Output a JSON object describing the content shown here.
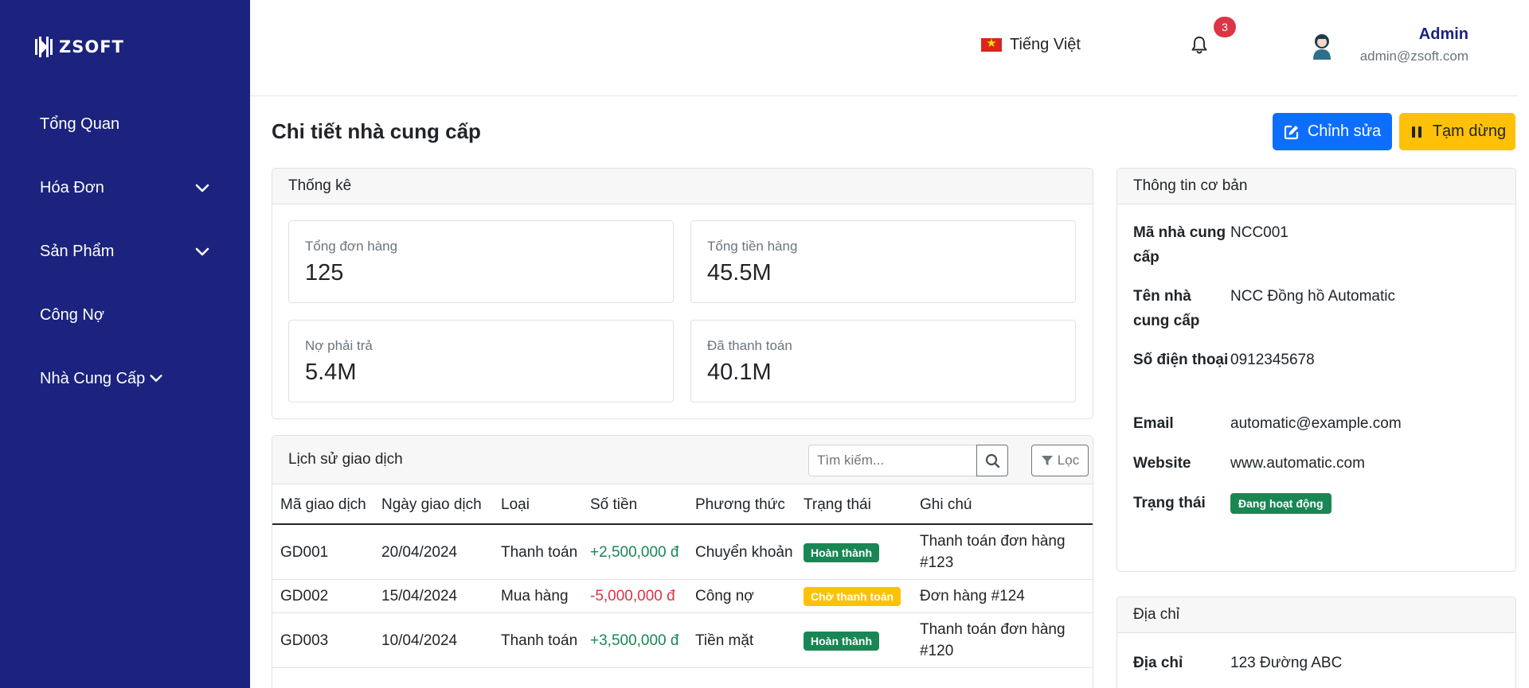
{
  "app": {
    "logo_text": "ZSOFT"
  },
  "sidebar": {
    "items": [
      {
        "label": "Tổng Quan",
        "has_chevron": false
      },
      {
        "label": "Hóa Đơn",
        "has_chevron": true
      },
      {
        "label": "Sản Phẩm",
        "has_chevron": true
      },
      {
        "label": "Công Nợ",
        "has_chevron": false
      },
      {
        "label": "Nhà Cung Cấp",
        "has_chevron": true
      }
    ],
    "bg_color": "#1b237e"
  },
  "header": {
    "language": "Tiếng Việt",
    "notification_count": "3",
    "user": {
      "name": "Admin",
      "email": "admin@zsoft.com"
    }
  },
  "page": {
    "title": "Chi tiết nhà cung cấp",
    "edit_label": "Chỉnh sửa",
    "pause_label": "Tạm dừng"
  },
  "stats": {
    "header": "Thống kê",
    "items": [
      {
        "label": "Tổng đơn hàng",
        "value": "125"
      },
      {
        "label": "Tổng tiền hàng",
        "value": "45.5M"
      },
      {
        "label": "Nợ phải trả",
        "value": "5.4M"
      },
      {
        "label": "Đã thanh toán",
        "value": "40.1M"
      }
    ]
  },
  "transactions": {
    "header": "Lịch sử giao dịch",
    "search_placeholder": "Tìm kiếm...",
    "filter_label": "Lọc",
    "columns": [
      "Mã giao dịch",
      "Ngày giao dịch",
      "Loại",
      "Số tiền",
      "Phương thức",
      "Trạng thái",
      "Ghi chú"
    ],
    "rows": [
      {
        "id": "GD001",
        "date": "20/04/2024",
        "type": "Thanh toán",
        "amount": "+2,500,000 đ",
        "method": "Chuyển khoản",
        "status": "Hoàn thành",
        "note": "Thanh toán đơn hàng #123"
      },
      {
        "id": "GD002",
        "date": "15/04/2024",
        "type": "Mua hàng",
        "amount": "-5,000,000 đ",
        "method": "Công nợ",
        "status": "Chờ thanh toán",
        "note": "Đơn hàng #124"
      },
      {
        "id": "GD003",
        "date": "10/04/2024",
        "type": "Thanh toán",
        "amount": "+3,500,000 đ",
        "method": "Tiền mặt",
        "status": "Hoàn thành",
        "note": "Thanh toán đơn hàng #120"
      }
    ]
  },
  "basic_info": {
    "header": "Thông tin cơ bản",
    "code_label": "Mã nhà cung cấp",
    "code": "NCC001",
    "name_label": "Tên nhà cung cấp",
    "name": "NCC Đồng hồ Automatic",
    "phone_label": "Số điện thoại",
    "phone": "0912345678",
    "email_label": "Email",
    "email": "automatic@example.com",
    "website_label": "Website",
    "website": "www.automatic.com",
    "status_label": "Trạng thái",
    "status": "Đang hoạt động"
  },
  "address": {
    "header": "Địa chỉ",
    "label": "Địa chỉ",
    "value": "123 Đường ABC"
  },
  "colors": {
    "primary": "#0d6efd",
    "warning": "#ffc107",
    "success": "#198754",
    "danger": "#dc3545"
  }
}
